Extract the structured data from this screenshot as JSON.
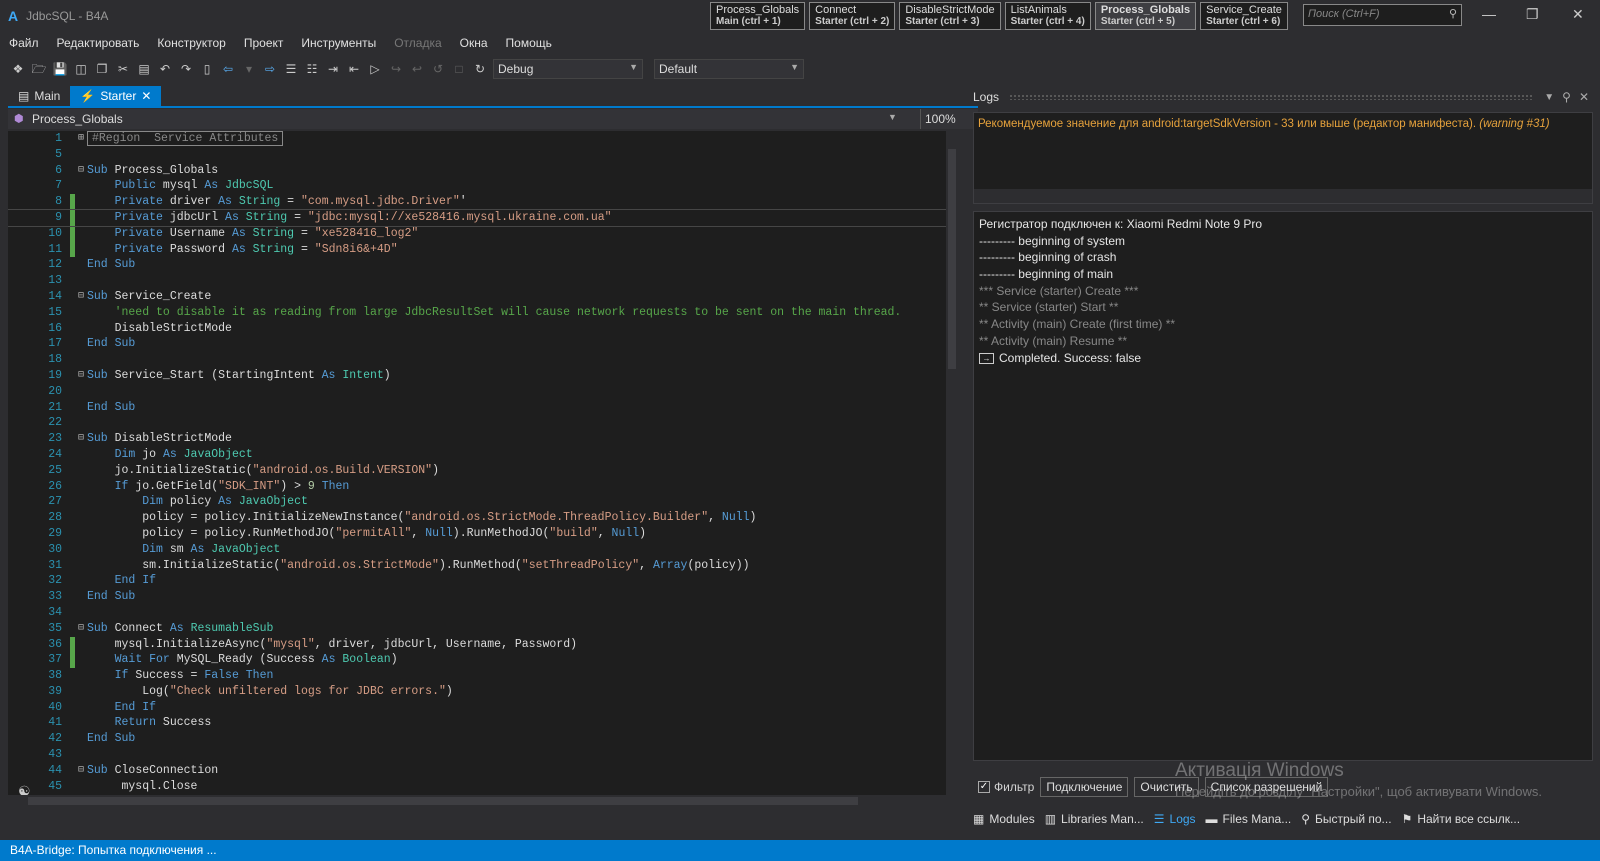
{
  "window": {
    "logo": "A",
    "title": "JdbcSQL - B4A"
  },
  "quick_tabs": [
    {
      "name": "Process_Globals",
      "sub": "Main  (ctrl + 1)"
    },
    {
      "name": "Connect",
      "sub": "Starter  (ctrl + 2)"
    },
    {
      "name": "DisableStrictMode",
      "sub": "Starter  (ctrl + 3)"
    },
    {
      "name": "ListAnimals",
      "sub": "Starter  (ctrl + 4)"
    },
    {
      "name": "Process_Globals",
      "sub": "Starter  (ctrl + 5)"
    },
    {
      "name": "Service_Create",
      "sub": "Starter  (ctrl + 6)"
    }
  ],
  "search": {
    "placeholder": "Поиск (Ctrl+F)"
  },
  "menu": [
    "Файл",
    "Редактировать",
    "Конструктор",
    "Проект",
    "Инструменты",
    "Отладка",
    "Окна",
    "Помощь"
  ],
  "toolbar": {
    "build_mode": "Debug",
    "config": "Default"
  },
  "editor_tabs": [
    {
      "label": "Main"
    },
    {
      "label": "Starter"
    }
  ],
  "procedure": "Process_Globals",
  "zoom": "100%",
  "code_lines": [
    {
      "n": "1",
      "t": "#Region  Service Attributes"
    },
    {
      "n": "5",
      "t": ""
    },
    {
      "n": "6",
      "t": "Sub Process_Globals"
    },
    {
      "n": "7",
      "t": "    Public mysql As JdbcSQL"
    },
    {
      "n": "8",
      "t": "    Private driver As String = \"com.mysql.jdbc.Driver\"'"
    },
    {
      "n": "9",
      "t": "    Private jdbcUrl As String = \"jdbc:mysql://xe528416.mysql.ukraine.com.ua\""
    },
    {
      "n": "10",
      "t": "    Private Username As String = \"xe528416_log2\""
    },
    {
      "n": "11",
      "t": "    Private Password As String = \"Sdn8i6&+4D\""
    },
    {
      "n": "12",
      "t": "End Sub"
    },
    {
      "n": "13",
      "t": ""
    },
    {
      "n": "14",
      "t": "Sub Service_Create"
    },
    {
      "n": "15",
      "t": "    'need to disable it as reading from large JdbcResultSet will cause network requests to be sent on the main thread."
    },
    {
      "n": "16",
      "t": "    DisableStrictMode"
    },
    {
      "n": "17",
      "t": "End Sub"
    },
    {
      "n": "18",
      "t": ""
    },
    {
      "n": "19",
      "t": "Sub Service_Start (StartingIntent As Intent)"
    },
    {
      "n": "20",
      "t": ""
    },
    {
      "n": "21",
      "t": "End Sub"
    },
    {
      "n": "22",
      "t": ""
    },
    {
      "n": "23",
      "t": "Sub DisableStrictMode"
    },
    {
      "n": "24",
      "t": "    Dim jo As JavaObject"
    },
    {
      "n": "25",
      "t": "    jo.InitializeStatic(\"android.os.Build.VERSION\")"
    },
    {
      "n": "26",
      "t": "    If jo.GetField(\"SDK_INT\") > 9 Then"
    },
    {
      "n": "27",
      "t": "        Dim policy As JavaObject"
    },
    {
      "n": "28",
      "t": "        policy = policy.InitializeNewInstance(\"android.os.StrictMode.ThreadPolicy.Builder\", Null)"
    },
    {
      "n": "29",
      "t": "        policy = policy.RunMethodJO(\"permitAll\", Null).RunMethodJO(\"build\", Null)"
    },
    {
      "n": "30",
      "t": "        Dim sm As JavaObject"
    },
    {
      "n": "31",
      "t": "        sm.InitializeStatic(\"android.os.StrictMode\").RunMethod(\"setThreadPolicy\", Array(policy))"
    },
    {
      "n": "32",
      "t": "    End If"
    },
    {
      "n": "33",
      "t": "End Sub"
    },
    {
      "n": "34",
      "t": ""
    },
    {
      "n": "35",
      "t": "Sub Connect As ResumableSub"
    },
    {
      "n": "36",
      "t": "    mysql.InitializeAsync(\"mysql\", driver, jdbcUrl, Username, Password)"
    },
    {
      "n": "37",
      "t": "    Wait For MySQL_Ready (Success As Boolean)"
    },
    {
      "n": "38",
      "t": "    If Success = False Then"
    },
    {
      "n": "39",
      "t": "        Log(\"Check unfiltered logs for JDBC errors.\")"
    },
    {
      "n": "40",
      "t": "    End If"
    },
    {
      "n": "41",
      "t": "    Return Success"
    },
    {
      "n": "42",
      "t": "End Sub"
    },
    {
      "n": "43",
      "t": ""
    },
    {
      "n": "44",
      "t": "Sub CloseConnection"
    },
    {
      "n": "45",
      "t": "     mysql.Close"
    }
  ],
  "logs": {
    "title": "Logs",
    "warning": "Рекомендуемое значение для android:targetSdkVersion - 33 или выше (редактор манифеста).",
    "warning_tag": "(warning #31)",
    "lines": [
      {
        "text": "Регистратор подключен к:  Xiaomi Redmi Note 9 Pro",
        "dim": false
      },
      {
        "text": "--------- beginning of system",
        "dim": false
      },
      {
        "text": "--------- beginning of crash",
        "dim": false
      },
      {
        "text": "--------- beginning of main",
        "dim": false
      },
      {
        "text": "*** Service (starter) Create ***",
        "dim": true
      },
      {
        "text": "** Service (starter) Start **",
        "dim": true
      },
      {
        "text": "** Activity (main) Create (first time) **",
        "dim": true
      },
      {
        "text": "** Activity (main) Resume **",
        "dim": true
      }
    ],
    "completed": "Completed. Success: false",
    "filter_label": "Фильтр",
    "buttons": [
      "Подключение",
      "Очистить",
      "Список разрешений"
    ]
  },
  "watermark": {
    "line1": "Активація Windows",
    "line2": "Перейдіть до розділу \"Настройки\", щоб активувати Windows."
  },
  "bottom_tabs": [
    {
      "icon": "modules-icon",
      "label": "Modules"
    },
    {
      "icon": "libraries-icon",
      "label": "Libraries Man..."
    },
    {
      "icon": "logs-icon",
      "label": "Logs"
    },
    {
      "icon": "folder-icon",
      "label": "Files Mana..."
    },
    {
      "icon": "search-icon",
      "label": "Быстрый по..."
    },
    {
      "icon": "find-refs-icon",
      "label": "Найти все ссылк..."
    }
  ],
  "status": "B4A-Bridge: Попытка подключения ..."
}
